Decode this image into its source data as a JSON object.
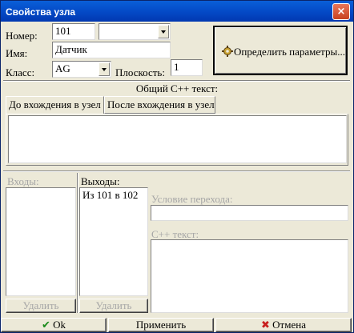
{
  "window": {
    "title": "Свойства узла",
    "close_glyph": "×"
  },
  "fields": {
    "number_label": "Номер:",
    "number_value": "101",
    "number_combo_value": "",
    "name_label": "Имя:",
    "name_value": "Датчик",
    "class_label": "Класс:",
    "class_value": "AG",
    "plane_label": "Плоскость:",
    "plane_value": "1"
  },
  "define_button": {
    "label": "Определить параметры...",
    "icon": "gear-icon"
  },
  "code": {
    "heading": "Общий C++ текст:",
    "tabs": [
      "До вхождения в узел",
      "После вхождения в узел"
    ],
    "active_tab": 0,
    "text": ""
  },
  "inputs": {
    "label": "Входы:",
    "items": [],
    "delete_label": "Удалить"
  },
  "outputs": {
    "label": "Выходы:",
    "items": [
      "Из 101 в 102"
    ],
    "delete_label": "Удалить"
  },
  "transition": {
    "condition_label": "Условие перехода:",
    "condition_value": "",
    "cpp_label": "C++ текст:",
    "cpp_value": ""
  },
  "footer": {
    "ok_label": "Ok",
    "ok_icon": "checkmark-icon",
    "ok_color": "#1a8a1a",
    "apply_label": "Применить",
    "cancel_label": "Отмена",
    "cancel_icon": "x-icon",
    "cancel_color": "#c81e1e"
  }
}
